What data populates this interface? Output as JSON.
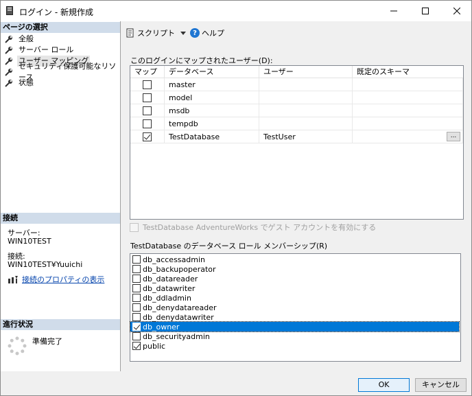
{
  "window": {
    "title": "ログイン - 新規作成"
  },
  "nav": {
    "header": "ページの選択",
    "items": [
      {
        "label": "全般",
        "selected": false
      },
      {
        "label": "サーバー ロール",
        "selected": false
      },
      {
        "label": "ユーザー マッピング",
        "selected": true
      },
      {
        "label": "セキュリティ保護可能なリソース",
        "selected": false
      },
      {
        "label": "状態",
        "selected": false
      }
    ]
  },
  "connection": {
    "header": "接続",
    "server_label": "サーバー:",
    "server_value": "WIN10TEST",
    "conn_label": "接続:",
    "conn_value": "WIN10TEST¥Yuuichi",
    "properties_link": "接続のプロパティの表示"
  },
  "progress": {
    "header": "進行状況",
    "status": "準備完了"
  },
  "toolbar": {
    "script_label": "スクリプト",
    "help_label": "ヘルプ"
  },
  "mapping": {
    "label": "このログインにマップされたユーザー(D):",
    "columns": [
      "マップ",
      "データベース",
      "ユーザー",
      "既定のスキーマ"
    ],
    "rows": [
      {
        "map": false,
        "database": "master",
        "user": "",
        "schema": ""
      },
      {
        "map": false,
        "database": "model",
        "user": "",
        "schema": ""
      },
      {
        "map": false,
        "database": "msdb",
        "user": "",
        "schema": ""
      },
      {
        "map": false,
        "database": "tempdb",
        "user": "",
        "schema": ""
      },
      {
        "map": true,
        "database": "TestDatabase",
        "user": "TestUser",
        "schema": ""
      }
    ],
    "ellipsis": "..."
  },
  "guest": {
    "label": "TestDatabase AdventureWorks でゲスト アカウントを有効にする",
    "checked": false,
    "enabled": false
  },
  "roles": {
    "label": "TestDatabase のデータベース ロール メンバーシップ(R)",
    "items": [
      {
        "name": "db_accessadmin",
        "checked": false,
        "selected": false
      },
      {
        "name": "db_backupoperator",
        "checked": false,
        "selected": false
      },
      {
        "name": "db_datareader",
        "checked": false,
        "selected": false
      },
      {
        "name": "db_datawriter",
        "checked": false,
        "selected": false
      },
      {
        "name": "db_ddladmin",
        "checked": false,
        "selected": false
      },
      {
        "name": "db_denydatareader",
        "checked": false,
        "selected": false
      },
      {
        "name": "db_denydatawriter",
        "checked": false,
        "selected": false
      },
      {
        "name": "db_owner",
        "checked": true,
        "selected": true
      },
      {
        "name": "db_securityadmin",
        "checked": false,
        "selected": false
      },
      {
        "name": "public",
        "checked": true,
        "selected": false
      }
    ]
  },
  "buttons": {
    "ok": "OK",
    "cancel": "キャンセル"
  }
}
